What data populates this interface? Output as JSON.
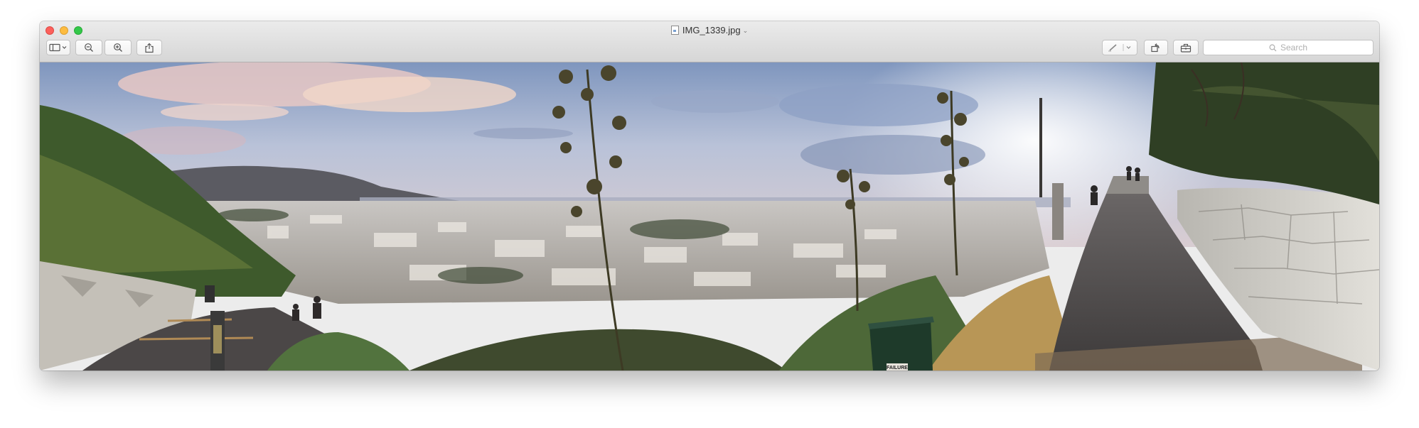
{
  "window": {
    "title": "IMG_1339.jpg",
    "title_chevron": "⌄"
  },
  "toolbar": {
    "sidebar_button": "sidebar-icon",
    "zoom_out_button": "zoom-out-icon",
    "zoom_in_button": "zoom-in-icon",
    "share_button": "share-icon",
    "markup_button": "pen-icon",
    "rotate_button": "rotate-icon",
    "toolbox_button": "toolbox-icon"
  },
  "search": {
    "placeholder": "Search"
  },
  "photo": {
    "trash_bin_label": "FAILURE"
  },
  "colors": {
    "close": "#fc605c",
    "minimize": "#fdbc40",
    "zoom": "#34c84a"
  }
}
